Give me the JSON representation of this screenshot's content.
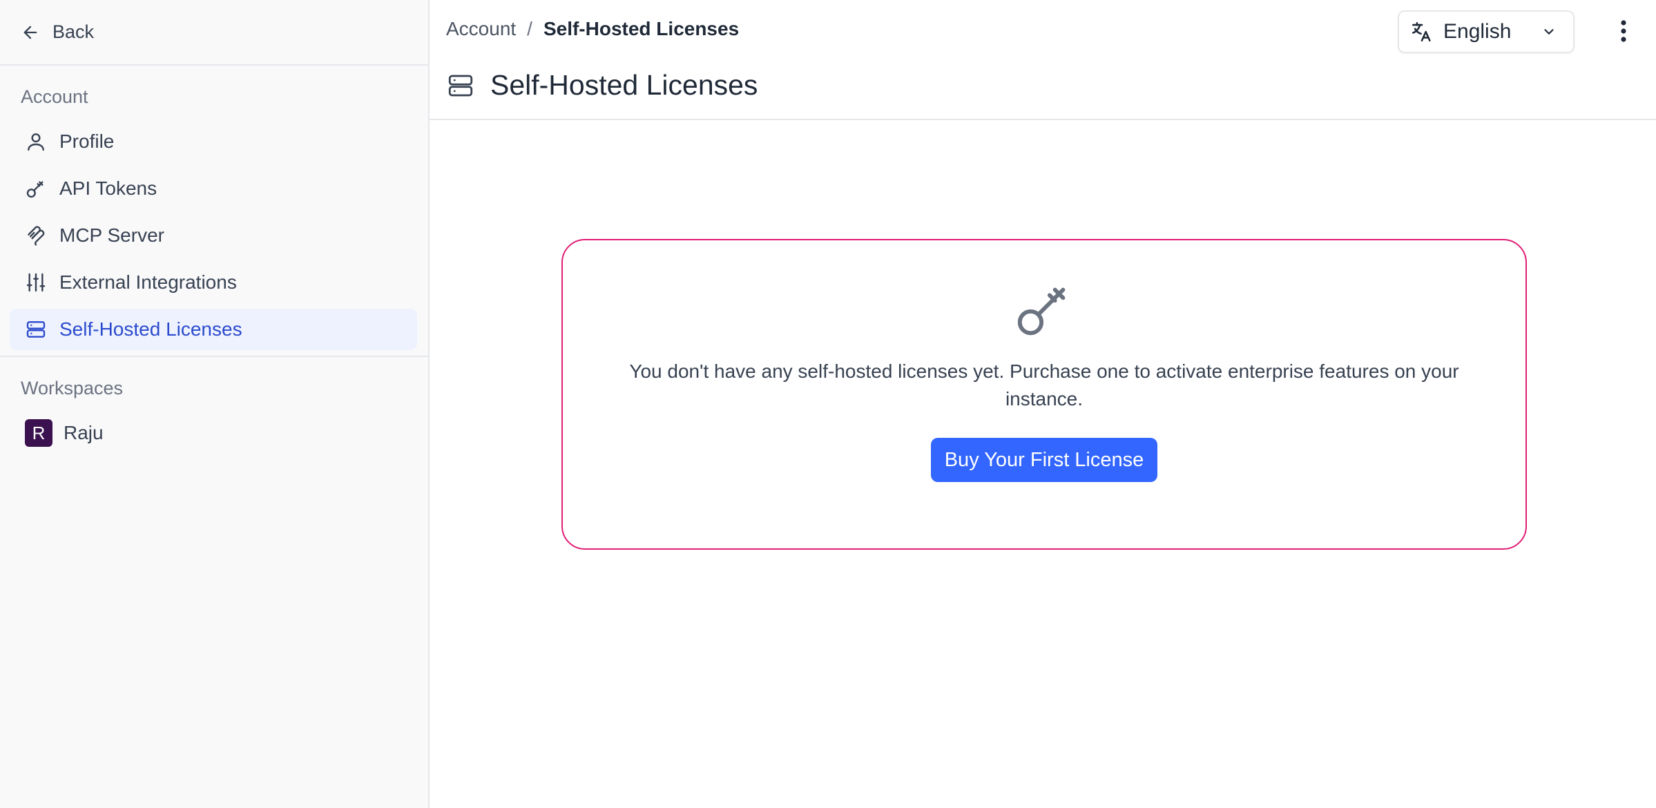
{
  "sidebar": {
    "back_label": "Back",
    "account_section": "Account",
    "items": [
      {
        "label": "Profile",
        "icon": "user-icon"
      },
      {
        "label": "API Tokens",
        "icon": "key-icon"
      },
      {
        "label": "MCP Server",
        "icon": "mcp-icon"
      },
      {
        "label": "External Integrations",
        "icon": "sliders-icon"
      },
      {
        "label": "Self-Hosted Licenses",
        "icon": "server-icon",
        "active": true
      }
    ],
    "workspaces_section": "Workspaces",
    "workspaces": [
      {
        "initial": "R",
        "name": "Raju",
        "color": "#3b1150"
      }
    ]
  },
  "header": {
    "breadcrumb_root": "Account",
    "breadcrumb_separator": "/",
    "breadcrumb_current": "Self-Hosted Licenses",
    "title": "Self-Hosted Licenses",
    "language": "English"
  },
  "empty_state": {
    "message": "You don't have any self-hosted licenses yet. Purchase one to activate enterprise features on your instance.",
    "button_label": "Buy Your First License"
  },
  "colors": {
    "accent": "#3366ff",
    "active_nav_bg": "#eef2ff",
    "active_nav_text": "#2b4bcc",
    "card_border": "#e11d74"
  }
}
